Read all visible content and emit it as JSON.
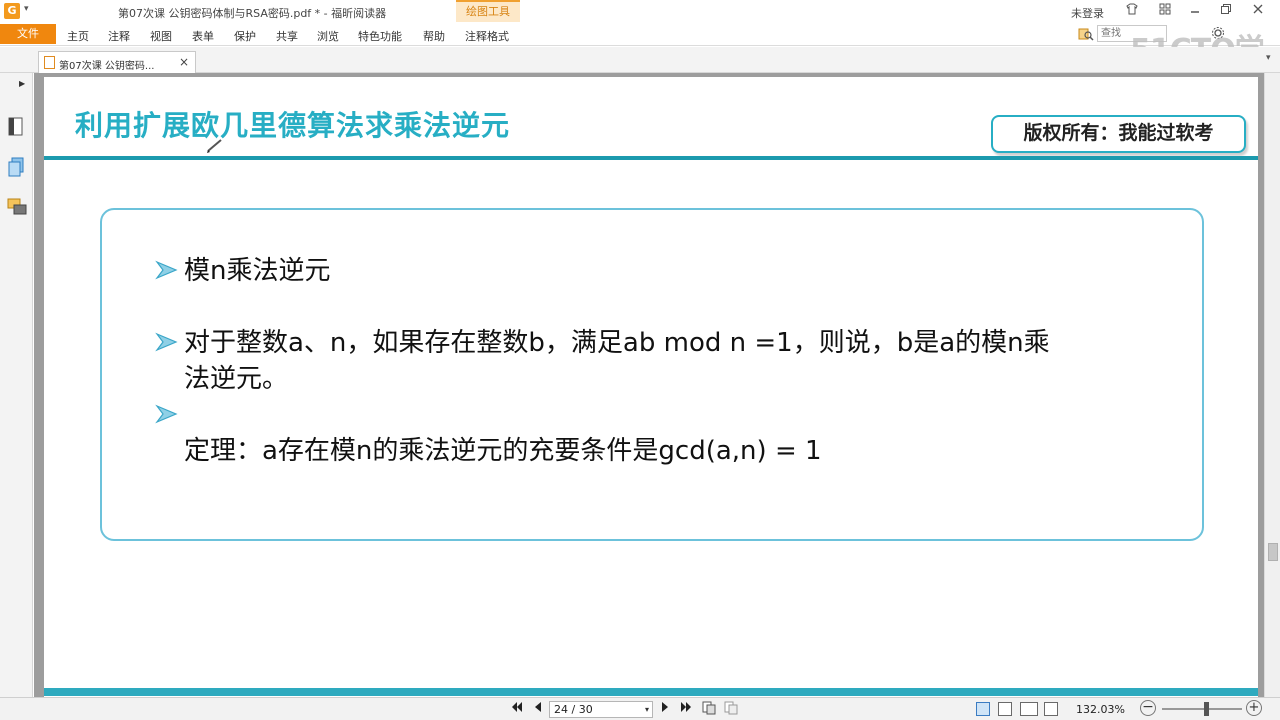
{
  "window": {
    "title": "第07次课 公钥密码体制与RSA密码.pdf * - 福昕阅读器",
    "context_tab": "绘图工具",
    "user_status": "未登录",
    "quick_access_arrow": "▾"
  },
  "menu": {
    "file": "文件",
    "items": [
      "主页",
      "注释",
      "视图",
      "表单",
      "保护",
      "共享",
      "浏览",
      "特色功能",
      "帮助",
      "注释格式"
    ],
    "search_placeholder": "查找"
  },
  "watermark": "51CTO学院",
  "tabs": [
    {
      "title": "第07次课 公钥密码...",
      "close": "×"
    }
  ],
  "slide": {
    "title": "利用扩展欧几里德算法求乘法逆元",
    "copyright": "版权所有：我能过软考",
    "bullets": [
      "模n乘法逆元",
      "对于整数a、n，如果存在整数b，满足ab mod n =1，则说，b是a的模n乘法逆元。",
      "",
      "定理：a存在模n的乘法逆元的充要条件是gcd(a,n) = 1"
    ],
    "bullet_line2": "法逆元。",
    "bullet_line1": "对于整数a、n，如果存在整数b，满足ab mod n =1，则说，b是a的模n乘"
  },
  "status": {
    "page_display": "24 / 30",
    "current_page": 24,
    "total_pages": 30,
    "zoom": "132.03%",
    "zoom_slider_fraction": 0.55
  },
  "colors": {
    "accent_orange": "#f0870e",
    "title_teal": "#27aec4",
    "rule_teal": "#1c9aae",
    "box_border": "#6cc2db"
  },
  "icons": {
    "app": "foxit-logo-icon",
    "bookmark_panel": "bookmark-icon",
    "pages_panel": "pages-icon",
    "comments_panel": "comments-icon",
    "find": "find-icon"
  }
}
